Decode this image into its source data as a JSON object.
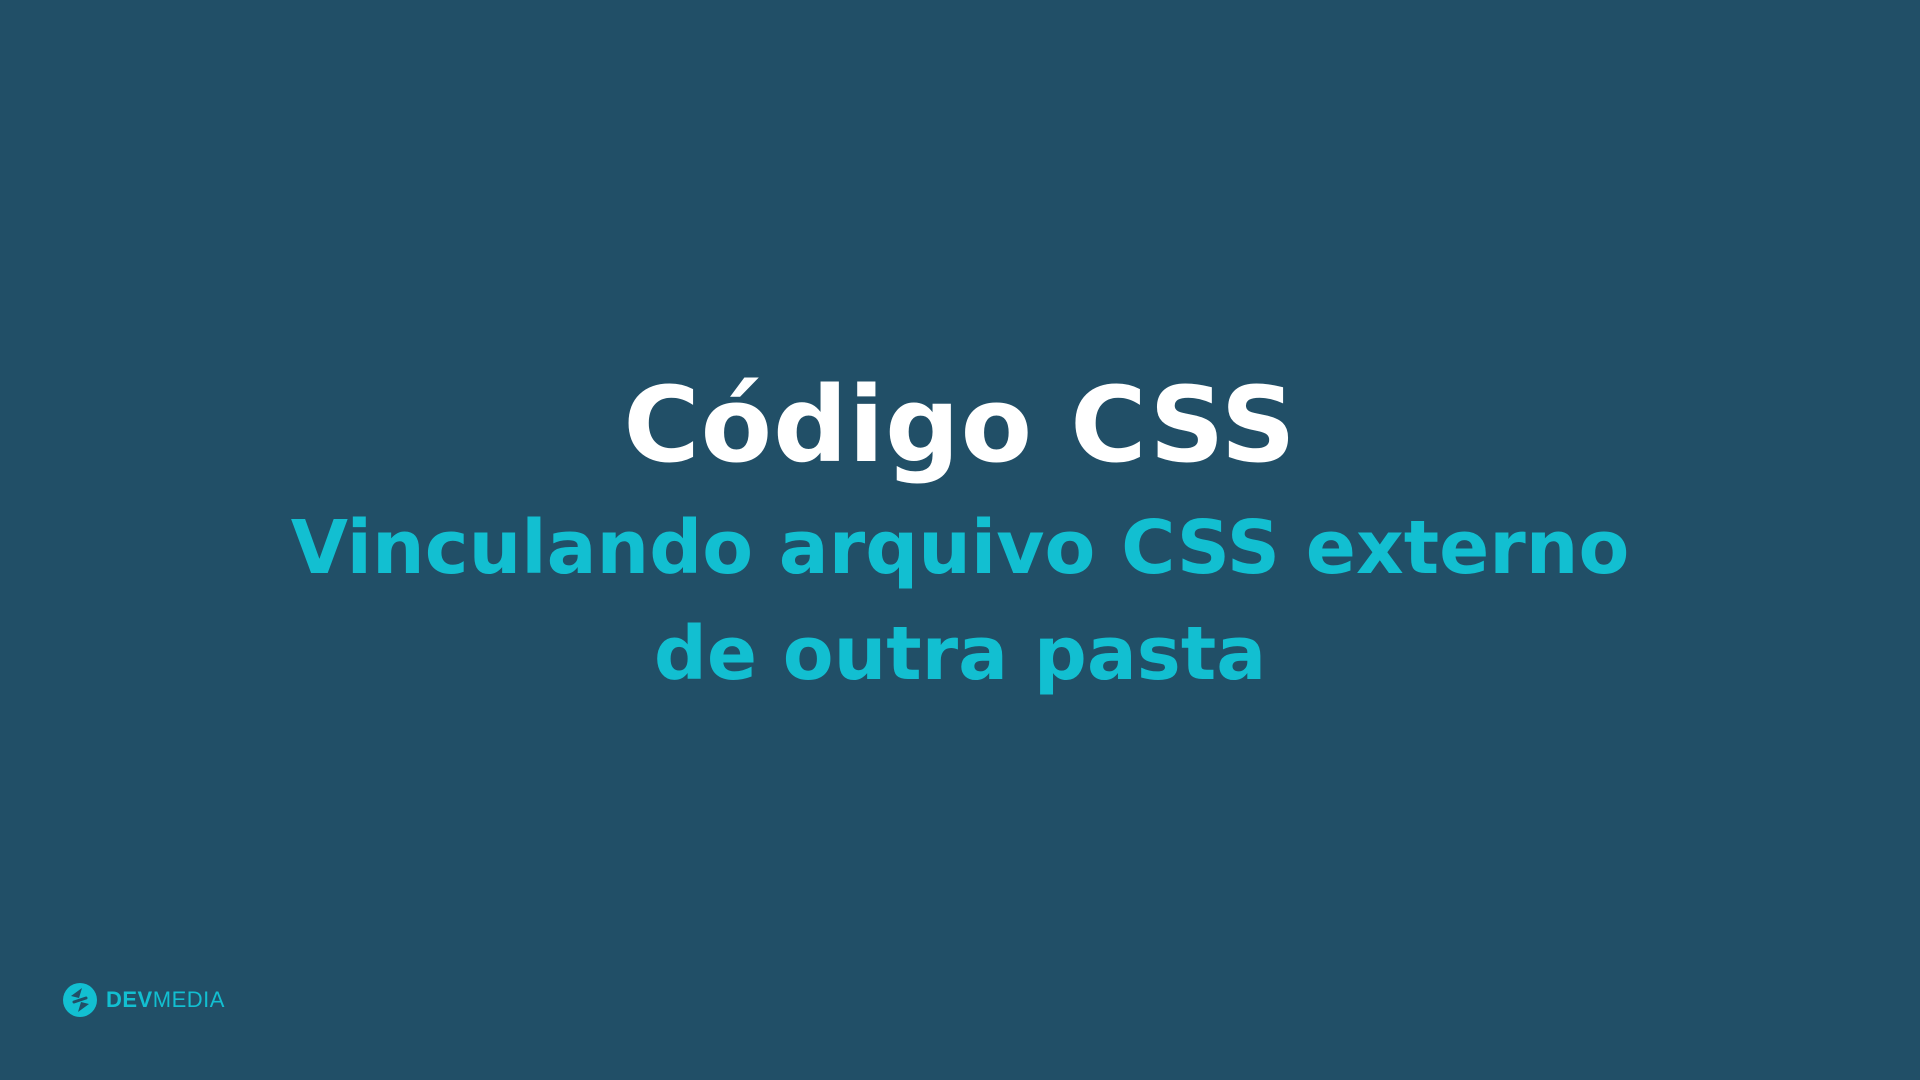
{
  "slide": {
    "title": "Código CSS",
    "subtitle_line1": "Vinculando arquivo CSS externo",
    "subtitle_line2": "de outra pasta"
  },
  "logo": {
    "icon": "devmedia-logo-icon",
    "text_bold": "DEV",
    "text_regular": "MEDIA"
  },
  "colors": {
    "background": "#214f67",
    "title": "#ffffff",
    "subtitle": "#12bfd1",
    "logo": "#12bfd1"
  }
}
